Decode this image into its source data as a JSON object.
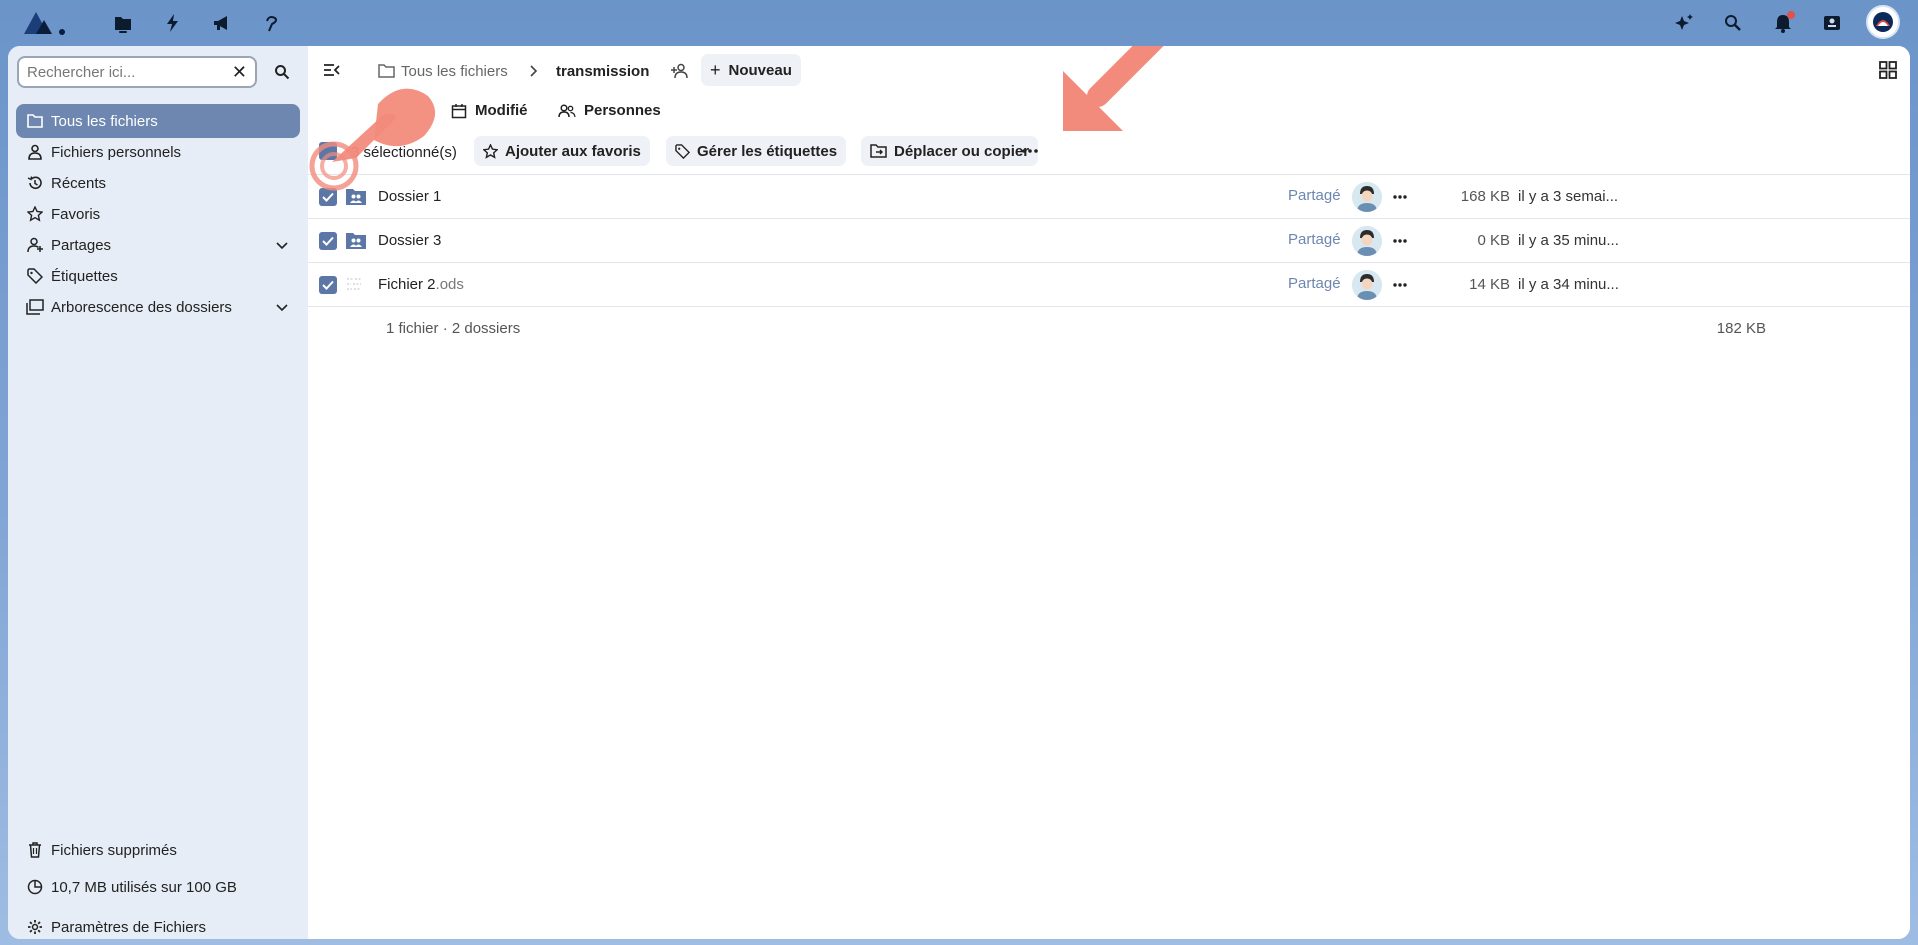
{
  "topbar": {
    "apps": [
      "files-icon",
      "activity-icon",
      "announcements-icon",
      "custom-app-icon"
    ],
    "right": [
      "assistant-icon",
      "search-icon",
      "notifications-icon",
      "contacts-icon"
    ]
  },
  "sidebar": {
    "search_placeholder": "Rechercher ici...",
    "items": [
      {
        "label": "Tous les fichiers",
        "icon": "folder-icon"
      },
      {
        "label": "Fichiers personnels",
        "icon": "person-icon"
      },
      {
        "label": "Récents",
        "icon": "history-icon"
      },
      {
        "label": "Favoris",
        "icon": "star-icon"
      },
      {
        "label": "Partages",
        "icon": "share-icon"
      },
      {
        "label": "Étiquettes",
        "icon": "tag-icon"
      },
      {
        "label": "Arborescence des dossiers",
        "icon": "folder-tree-icon"
      }
    ],
    "bottom": {
      "trash": "Fichiers supprimés",
      "quota": "10,7 MB utilisés sur 100 GB",
      "settings": "Paramètres de Fichiers"
    }
  },
  "header": {
    "crumb_root": "Tous les fichiers",
    "crumb_current": "transmission",
    "new_label": "Nouveau"
  },
  "filters": {
    "modified": "Modifié",
    "people": "Personnes"
  },
  "selection": {
    "count_label": "3 sélectionné(s)",
    "favorite": "Ajouter aux favoris",
    "tags": "Gérer les étiquettes",
    "move": "Déplacer ou copier"
  },
  "files": [
    {
      "name": "Dossier 1",
      "ext": "",
      "share": "Partagé",
      "size": "168 KB",
      "date": "il y a 3 semai..."
    },
    {
      "name": "Dossier 3",
      "ext": "",
      "share": "Partagé",
      "size": "0 KB",
      "date": "il y a 35 minu..."
    },
    {
      "name": "Fichier 2",
      "ext": ".ods",
      "share": "Partagé",
      "size": "14 KB",
      "date": "il y a 34 minu..."
    }
  ],
  "summary": {
    "count": "1 fichier · 2 dossiers",
    "size": "182 KB"
  },
  "colors": {
    "accent": "#6d87b0",
    "arrow": "#f28b7c"
  }
}
